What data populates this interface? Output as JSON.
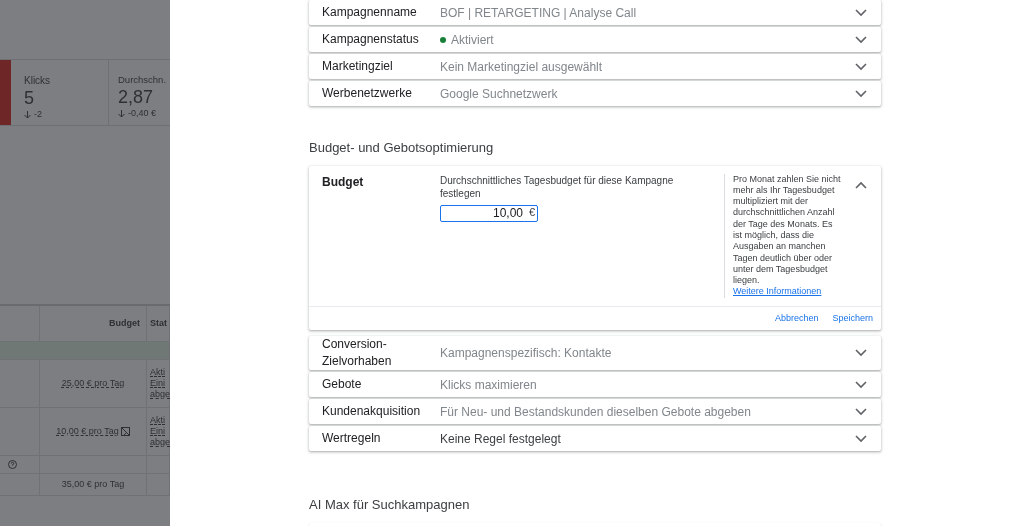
{
  "background": {
    "metrics": [
      {
        "label": "Klicks",
        "value": "5",
        "change": "-2"
      },
      {
        "label": "Durchschn.",
        "value": "2,87",
        "change": "-0,40 €"
      }
    ],
    "table": {
      "columns": [
        "Budget",
        "Stat"
      ],
      "rows": [
        {
          "budget": "25,00 € pro Tag",
          "status": [
            "Akti",
            "Eini",
            "abge"
          ],
          "warning": false
        },
        {
          "budget": "10,00 € pro Tag",
          "status": [
            "Akti",
            "Eini",
            "abge"
          ],
          "warning": true
        }
      ],
      "total": "35,00 € pro Tag"
    }
  },
  "sections": [
    {
      "rows": [
        {
          "kind": "setting",
          "label": "Kampagnenname",
          "value": "BOF | RETARGETING | Analyse Call",
          "muted": true,
          "expanded": false
        },
        {
          "kind": "setting",
          "label": "Kampagnenstatus",
          "value": "Aktiviert",
          "color": "#188038",
          "muted": true,
          "expanded": false
        },
        {
          "kind": "setting",
          "label": "Marketingziel",
          "value": "Kein Marketingziel ausgewählt",
          "muted": true,
          "expanded": false
        },
        {
          "kind": "setting",
          "label": "Werbenetzwerke",
          "value": "Google Suchnetzwerk",
          "muted": true,
          "expanded": false
        }
      ]
    },
    {
      "title": "Budget- und Gebotsoptimierung",
      "rows": [
        {
          "kind": "editor",
          "label": "Budget",
          "description": "Durchschnittliches Tagesbudget für diese Kampagne festlegen",
          "input_value": "10,00",
          "currency": "€",
          "help": "Pro Monat zahlen Sie nicht mehr als Ihr Tagesbudget multipliziert mit der durchschnittlichen Anzahl der Tage des Monats. Es ist möglich, dass die Ausgaben an manchen Tagen deutlich über oder unter dem Tagesbudget liegen.",
          "link": "Weitere Informationen",
          "actions": [
            "Abbrechen",
            "Speichern"
          ],
          "expanded": true
        },
        {
          "kind": "setting",
          "label": "Conversion-Zielvorhaben",
          "value": "Kampagnenspezifisch: Kontakte",
          "muted": true,
          "expanded": false
        },
        {
          "kind": "setting",
          "label": "Gebote",
          "value": "Klicks maximieren",
          "muted": true,
          "expanded": false
        },
        {
          "kind": "setting",
          "label": "Kundenakquisition",
          "value": "Für Neu- und Bestandskunden dieselben Gebote abgeben",
          "muted": true,
          "expanded": false
        },
        {
          "kind": "setting",
          "label": "Wertregeln",
          "value": "Keine Regel festgelegt",
          "muted": false,
          "expanded": false
        }
      ]
    },
    {
      "title": "AI Max für Suchkampagnen"
    }
  ]
}
